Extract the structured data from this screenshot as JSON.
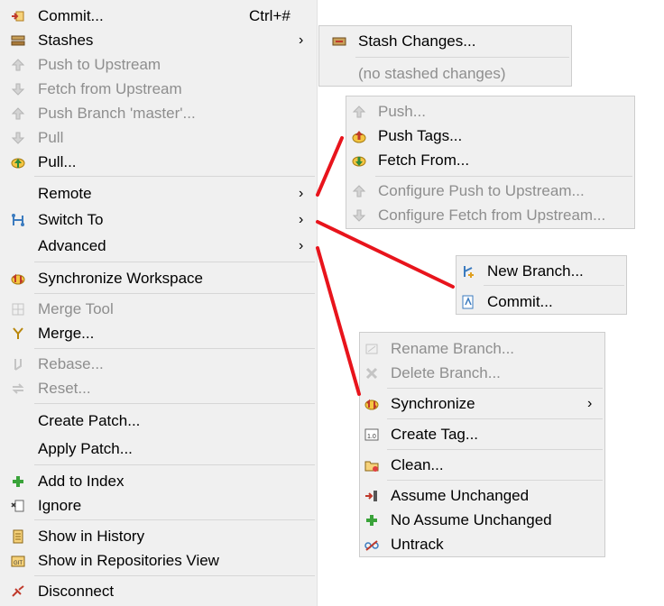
{
  "main_menu": {
    "items": [
      {
        "label": "Commit...",
        "accel": "Ctrl+#",
        "icon": "commit-icon"
      },
      {
        "label": "Stashes",
        "icon": "stash-icon"
      },
      {
        "label": "Push to Upstream",
        "icon": "push-upstream-icon"
      },
      {
        "label": "Fetch from Upstream",
        "icon": "fetch-upstream-icon"
      },
      {
        "label": "Push Branch 'master'...",
        "icon": "push-branch-icon"
      },
      {
        "label": "Pull",
        "icon": "pull-icon"
      },
      {
        "label": "Pull...",
        "icon": "pull-dialog-icon"
      },
      {
        "label": "Remote"
      },
      {
        "label": "Switch To",
        "icon": "switch-branch-icon"
      },
      {
        "label": "Advanced"
      },
      {
        "label": "Synchronize Workspace",
        "icon": "synchronize-icon"
      },
      {
        "label": "Merge Tool",
        "icon": "merge-tool-icon"
      },
      {
        "label": "Merge...",
        "icon": "merge-icon"
      },
      {
        "label": "Rebase...",
        "icon": "rebase-icon"
      },
      {
        "label": "Reset...",
        "icon": "reset-icon"
      },
      {
        "label": "Create Patch..."
      },
      {
        "label": "Apply Patch..."
      },
      {
        "label": "Add to Index",
        "icon": "add-index-icon"
      },
      {
        "label": "Ignore",
        "icon": "ignore-icon"
      },
      {
        "label": "Show in History",
        "icon": "history-icon"
      },
      {
        "label": "Show in Repositories View",
        "icon": "repositories-icon"
      },
      {
        "label": "Disconnect",
        "icon": "disconnect-icon"
      }
    ]
  },
  "stashes_menu": {
    "items": [
      {
        "label": "Stash Changes...",
        "icon": "stash-changes-icon"
      },
      {
        "label": "(no stashed changes)"
      }
    ]
  },
  "remote_menu": {
    "items": [
      {
        "label": "Push...",
        "icon": "push-icon"
      },
      {
        "label": "Push Tags...",
        "icon": "push-tags-icon"
      },
      {
        "label": "Fetch From...",
        "icon": "fetch-from-icon"
      },
      {
        "label": "Configure Push to Upstream...",
        "icon": "configure-push-icon"
      },
      {
        "label": "Configure Fetch from Upstream...",
        "icon": "configure-fetch-icon"
      }
    ]
  },
  "switch_menu": {
    "items": [
      {
        "label": "New Branch...",
        "icon": "new-branch-icon"
      },
      {
        "label": "Commit...",
        "icon": "commit-checkout-icon"
      }
    ]
  },
  "advanced_menu": {
    "items": [
      {
        "label": "Rename Branch...",
        "icon": "rename-branch-icon"
      },
      {
        "label": "Delete Branch...",
        "icon": "delete-branch-icon"
      },
      {
        "label": "Synchronize",
        "icon": "synchronize-icon"
      },
      {
        "label": "Create Tag...",
        "icon": "tag-icon"
      },
      {
        "label": "Clean...",
        "icon": "clean-icon"
      },
      {
        "label": "Assume Unchanged",
        "icon": "assume-unchanged-icon"
      },
      {
        "label": "No Assume Unchanged",
        "icon": "no-assume-unchanged-icon"
      },
      {
        "label": "Untrack",
        "icon": "untrack-icon"
      }
    ]
  },
  "colors": {
    "menu_bg": "#f0f0f0",
    "disabled_text": "#8e8e8e",
    "callout": "#e8141c"
  }
}
